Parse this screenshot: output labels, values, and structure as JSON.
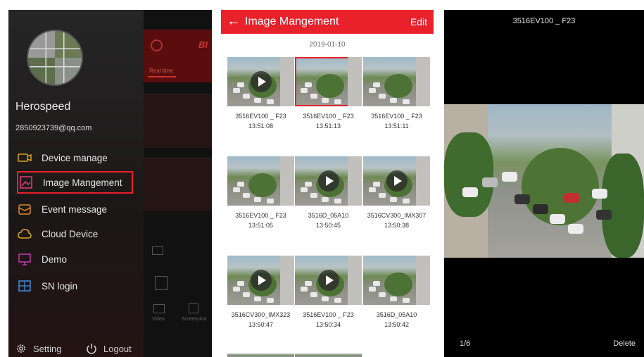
{
  "colors": {
    "accent": "#e8212b",
    "drawer_bg": "#1b1b1b",
    "viewer_bg": "#000000"
  },
  "drawer": {
    "username": "Herospeed",
    "email": "2850923739@qq.com",
    "menu": [
      {
        "label": "Device manage",
        "icon": "camera-icon",
        "selected": false
      },
      {
        "label": "Image Mangement",
        "icon": "image-icon",
        "selected": true
      },
      {
        "label": "Event message",
        "icon": "message-icon",
        "selected": false
      },
      {
        "label": "Cloud Device",
        "icon": "cloud-icon",
        "selected": false
      },
      {
        "label": "Demo",
        "icon": "monitor-icon",
        "selected": false
      },
      {
        "label": "SN login",
        "icon": "sn-icon",
        "selected": false
      }
    ],
    "setting_label": "Setting",
    "logout_label": "Logout",
    "background_app": {
      "title_fragment": "BI",
      "tab": "Real time",
      "btn_video": "Video",
      "btn_screenshot": "Screenshot"
    }
  },
  "gallery": {
    "title": "Image Mangement",
    "back_icon": "back-arrow-icon",
    "edit_label": "Edit",
    "date": "2019-01-10",
    "items": [
      {
        "name": "3516EV100 _ F23",
        "time": "13:51:08",
        "video": true,
        "selected": false
      },
      {
        "name": "3516EV100 _ F23",
        "time": "13:51:13",
        "video": false,
        "selected": true
      },
      {
        "name": "3516EV100 _ F23",
        "time": "13:51:11",
        "video": false,
        "selected": false
      },
      {
        "name": "3516EV100 _ F23",
        "time": "13:51:05",
        "video": false,
        "selected": false
      },
      {
        "name": "3516D_05A10",
        "time": "13:50:45",
        "video": true,
        "selected": false
      },
      {
        "name": "3516CV300_IMX307",
        "time": "13:50:38",
        "video": true,
        "selected": false
      },
      {
        "name": "3516CV300_IMX323",
        "time": "13:50:47",
        "video": true,
        "selected": false
      },
      {
        "name": "3516EV100 _ F23",
        "time": "13:50:34",
        "video": true,
        "selected": false
      },
      {
        "name": "3516D_05A10",
        "time": "13:50:42",
        "video": false,
        "selected": false
      }
    ]
  },
  "viewer": {
    "title": "3516EV100 _ F23",
    "counter": "1/6",
    "delete_label": "Delete"
  }
}
